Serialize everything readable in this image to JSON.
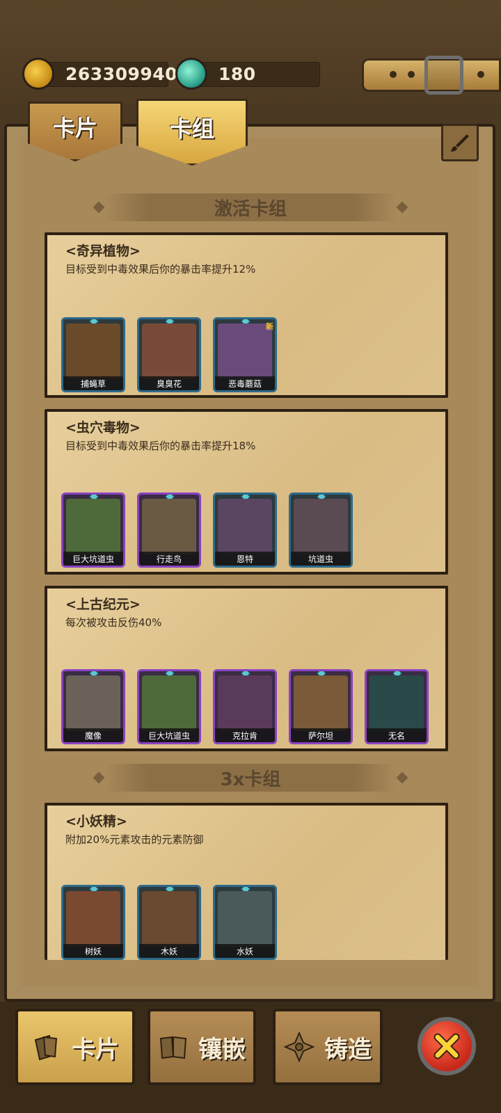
{
  "resources": {
    "gold_value": "263309940",
    "gem_value": "180",
    "gold_icon": "gold-coin-icon",
    "gem_icon": "crystal-gem-icon"
  },
  "tabs": [
    {
      "label": "卡片",
      "active": false
    },
    {
      "label": "卡组",
      "active": true
    }
  ],
  "sections": {
    "active": "激活卡组",
    "triple": "3x卡组"
  },
  "decks": [
    {
      "title": "<奇异植物>",
      "desc": "目标受到中毒效果后你的暴击率提升12%",
      "cards": [
        {
          "name": "捕蝇草",
          "rarity": "blue",
          "art": "#6b4a2a"
        },
        {
          "name": "臭臭花",
          "rarity": "blue",
          "art": "#7a4a38"
        },
        {
          "name": "恶毒蘑菇",
          "rarity": "blue",
          "art": "#6a4a7a",
          "badge": "新"
        }
      ]
    },
    {
      "title": "<虫穴毒物>",
      "desc": "目标受到中毒效果后你的暴击率提升18%",
      "cards": [
        {
          "name": "巨大坑道虫",
          "rarity": "purple",
          "art": "#4f6a3a"
        },
        {
          "name": "行走鸟",
          "rarity": "purple",
          "art": "#6a5a44"
        },
        {
          "name": "恩特",
          "rarity": "blue",
          "art": "#5a4660"
        },
        {
          "name": "坑道虫",
          "rarity": "blue",
          "art": "#5a4a52"
        }
      ]
    },
    {
      "title": "<上古纪元>",
      "desc": "每次被攻击反伤40%",
      "cards": [
        {
          "name": "魔像",
          "rarity": "purple",
          "art": "#6a6258"
        },
        {
          "name": "巨大坑道虫",
          "rarity": "purple",
          "art": "#4f6a3a"
        },
        {
          "name": "克拉肯",
          "rarity": "purple",
          "art": "#5a3a5a"
        },
        {
          "name": "萨尔坦",
          "rarity": "purple",
          "art": "#7a5a38"
        },
        {
          "name": "无名",
          "rarity": "purple",
          "art": "#2a4a4a"
        }
      ]
    },
    {
      "title": "<小妖精>",
      "desc": "附加20%元素攻击的元素防御",
      "cards": [
        {
          "name": "树妖",
          "rarity": "blue",
          "art": "#7a4a30"
        },
        {
          "name": "木妖",
          "rarity": "blue",
          "art": "#6a4a30"
        },
        {
          "name": "水妖",
          "rarity": "blue",
          "art": "#4a5a5a"
        }
      ]
    }
  ],
  "bottom_nav": [
    {
      "label": "卡片",
      "icon": "cards-icon",
      "active": true
    },
    {
      "label": "镶嵌",
      "icon": "inlay-book-icon",
      "active": false
    },
    {
      "label": "铸造",
      "icon": "forge-cross-icon",
      "active": false
    }
  ],
  "close": {
    "icon": "close-x-icon"
  },
  "colors": {
    "parchment": "#e7cf9c",
    "frame_dark": "#2d2012",
    "blue_frame": "#2e6a8a",
    "purple_frame": "#8a42c2",
    "close_red": "#c8281a"
  }
}
